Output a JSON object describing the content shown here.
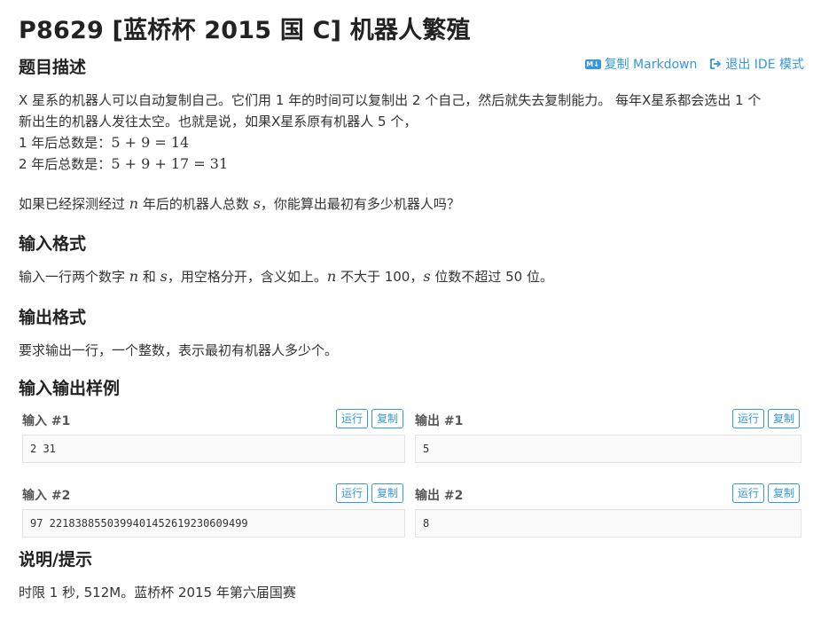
{
  "problem": {
    "title": "P8629 [蓝桥杯 2015 国 C] 机器人繁殖"
  },
  "toolbar": {
    "copy_markdown_label": "复制 Markdown",
    "exit_ide_label": "退出 IDE 模式"
  },
  "description": {
    "heading": "题目描述",
    "line1": "X 星系的机器人可以自动复制自己。它们用 1 年的时间可以复制出 2 个自己，然后就失去复制能力。 每年X星系都会选出 1 个",
    "line2": "新出生的机器人发往太空。也就是说，如果X星系原有机器人 5 个，",
    "line3_prefix": "1 年后总数是：",
    "line3_math": "5 + 9 = 14",
    "line4_prefix": "2 年后总数是：",
    "line4_math": "5 + 9 + 17 = 31",
    "question_part1": "如果已经探测经过 ",
    "question_n": "n",
    "question_part2": " 年后的机器人总数 ",
    "question_s": "s",
    "question_part3": "，你能算出最初有多少机器人吗？"
  },
  "input_format": {
    "heading": "输入格式",
    "part1": "输入一行两个数字 ",
    "n": "n",
    "part2": " 和 ",
    "s": "s",
    "part3": "，用空格分开，含义如上。",
    "n2": "n",
    "part4": " 不大于 100，",
    "s2": "s",
    "part5": " 位数不超过 50 位。"
  },
  "output_format": {
    "heading": "输出格式",
    "text": "要求输出一行，一个整数，表示最初有机器人多少个。"
  },
  "samples": {
    "heading": "输入输出样例",
    "run_label": "运行",
    "copy_label": "复制",
    "items": [
      {
        "input_label": "输入 #1",
        "input": "2 31",
        "output_label": "输出 #1",
        "output": "5"
      },
      {
        "input_label": "输入 #2",
        "input": "97 2218388550399401452619230609499",
        "output_label": "输出 #2",
        "output": "8"
      }
    ]
  },
  "hint": {
    "heading": "说明/提示",
    "text": "时限 1 秒, 512M。蓝桥杯 2015 年第六届国赛"
  }
}
